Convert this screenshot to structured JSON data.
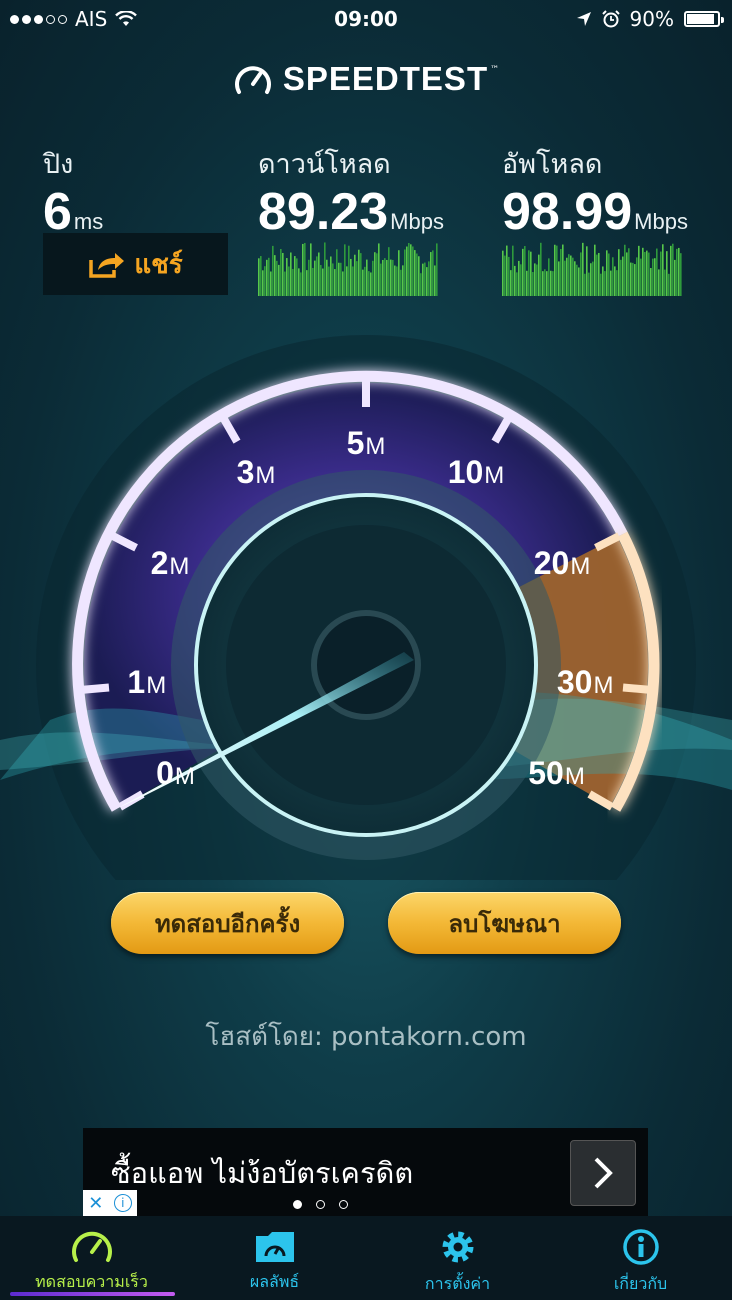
{
  "status": {
    "carrier": "AIS",
    "time": "09:00",
    "battery": "90%",
    "battery_level": 0.9
  },
  "app": {
    "title": "SPEEDTEST"
  },
  "ping": {
    "label": "ปิง",
    "value": "6",
    "unit": "ms"
  },
  "download": {
    "label": "ดาวน์โหลด",
    "value": "89.23",
    "unit": "Mbps"
  },
  "upload": {
    "label": "อัพโหลด",
    "value": "98.99",
    "unit": "Mbps"
  },
  "share": {
    "label": "แชร์"
  },
  "gauge": {
    "ticks": [
      {
        "num": "0",
        "unit": "M"
      },
      {
        "num": "1",
        "unit": "M"
      },
      {
        "num": "2",
        "unit": "M"
      },
      {
        "num": "3",
        "unit": "M"
      },
      {
        "num": "5",
        "unit": "M"
      },
      {
        "num": "10",
        "unit": "M"
      },
      {
        "num": "20",
        "unit": "M"
      },
      {
        "num": "30",
        "unit": "M"
      },
      {
        "num": "50",
        "unit": "M"
      }
    ]
  },
  "buttons": {
    "test_again": "ทดสอบอีกครั้ง",
    "remove_ads": "ลบโฆษณา"
  },
  "host": {
    "text": "โฮสต์โดย: pontakorn.com"
  },
  "ad": {
    "text": "ซื้อแอพ ไม่ง้อบัตรเครดิต"
  },
  "tabs": [
    {
      "label": "ทดสอบความเร็ว",
      "icon": "speedometer-icon"
    },
    {
      "label": "ผลลัพธ์",
      "icon": "folder-results-icon"
    },
    {
      "label": "การตั้งค่า",
      "icon": "gear-icon"
    },
    {
      "label": "เกี่ยวกับ",
      "icon": "info-icon"
    }
  ],
  "colors": {
    "accent_orange": "#f5a521",
    "tab_active": "#b7f04a",
    "tab_inactive": "#2cc4ec",
    "gauge_purple": "#8a63ff",
    "gauge_orange": "#f58a1f"
  }
}
